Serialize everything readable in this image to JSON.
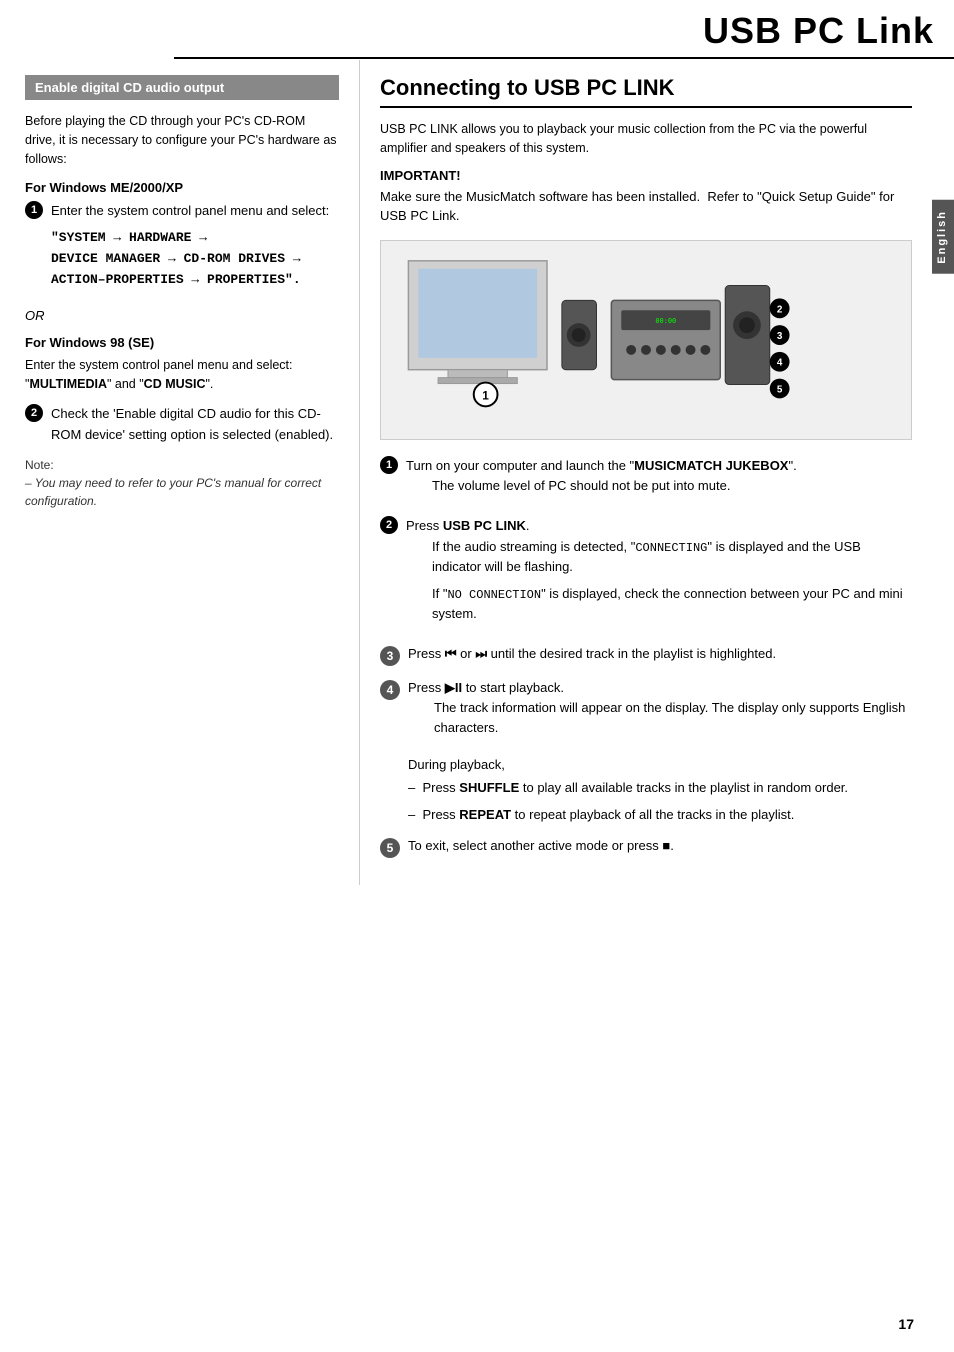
{
  "page": {
    "title": "USB PC Link",
    "page_number": "17",
    "lang_tab": "English"
  },
  "left": {
    "section_title": "Enable digital CD audio output",
    "intro_text": "Before playing the CD through your PC's CD-ROM drive, it is necessary to configure your PC's hardware as follows:",
    "windows_me_title": "For Windows ME/2000/XP",
    "windows_me_step": "Enter the system control panel menu and select:",
    "windows_me_path": "\"SYSTEM → HARDWARE →\nDEVICE MANAGER → CD-ROM DRIVES →\nACTION–PROPERTIES → PROPERTIES\".",
    "or_text": "OR",
    "windows_98_title": "For Windows 98 (SE)",
    "windows_98_step": "Enter the system control panel menu and select: \"MULTIMEDIA\" and \"CD MUSIC\".",
    "step2_text": "Check the 'Enable digital CD audio for this CD-ROM device' setting option is selected (enabled).",
    "note_label": "Note:",
    "note_text": "– You may need to refer to your PC's manual for correct configuration."
  },
  "right": {
    "section_title": "Connecting to USB PC LINK",
    "intro_text": "USB PC LINK allows you to playback your music collection from the PC via the powerful amplifier and speakers of this system.",
    "important_label": "IMPORTANT!",
    "important_text": "Make sure the MusicMatch software has been installed.  Refer to \"Quick Setup Guide\" for USB PC Link.",
    "step1_text": "Turn on your computer and launch the \"MUSICMATCH JUKEBOX\".",
    "step1_sub": "The volume level of PC should not be put into mute.",
    "step2_prefix": "Press ",
    "step2_bold": "USB PC LINK",
    "step2_suffix": ".",
    "step2_sub1": "If the audio streaming is detected, \"CONNECTING\" is displayed and the USB indicator will be flashing.",
    "step2_sub2": "If \"NO CONNECTION\" is displayed, check the connection between your PC and mini system.",
    "step3_prefix": "Press ",
    "step3_bold1": "⏮",
    "step3_or": " or ",
    "step3_bold2": "⏭",
    "step3_suffix": " until the desired track in the playlist is highlighted.",
    "step4_prefix": "Press ",
    "step4_icon": "▶II",
    "step4_suffix": "to start playback.",
    "step4_sub": "The track information will appear on the display.  The display only supports English characters.",
    "during_text": "During playback,",
    "dash1_prefix": "–  Press ",
    "dash1_bold": "SHUFFLE",
    "dash1_suffix": " to play all available tracks in the playlist in random order.",
    "dash2_prefix": "–  Press ",
    "dash2_bold": "REPEAT",
    "dash2_suffix": " to repeat playback of all the tracks in the playlist.",
    "step5_text": "To exit, select another active mode or press",
    "step5_icon": "■"
  }
}
